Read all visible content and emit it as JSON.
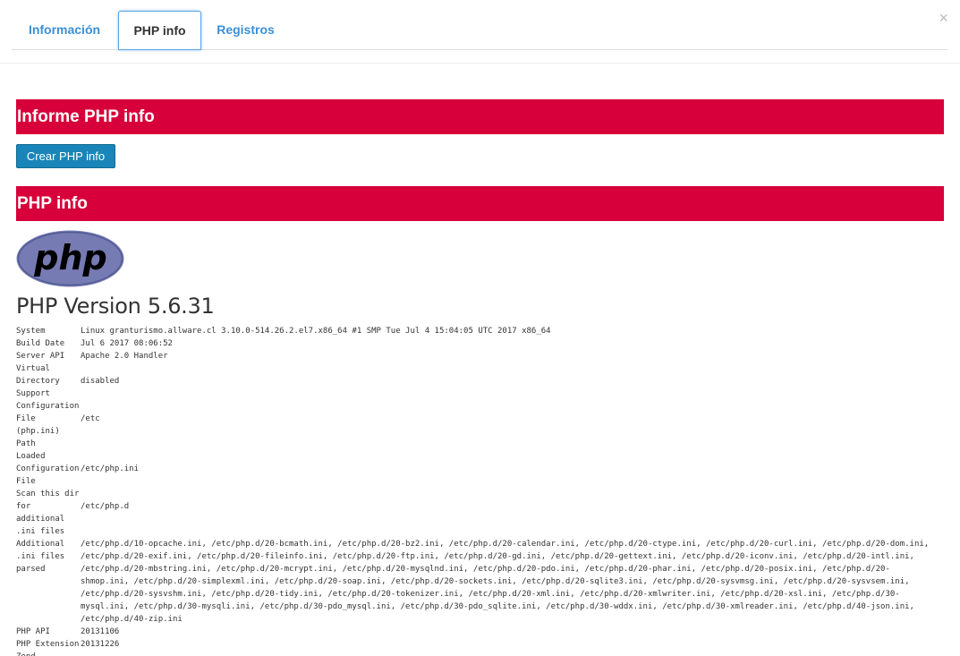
{
  "tabs": [
    {
      "label": "Información"
    },
    {
      "label": "PHP info"
    },
    {
      "label": "Registros"
    }
  ],
  "close_label": "×",
  "sections": {
    "informe_title": "Informe PHP info",
    "create_button": "Crear PHP info",
    "phpinfo_title": "PHP info"
  },
  "logo_text": "php",
  "php_version": "PHP Version 5.6.31",
  "colors": {
    "header_red": "#d7003a",
    "button_blue": "#1a85b8",
    "tab_link": "#3a8fd6"
  },
  "info": {
    "rows": [
      {
        "label": [
          "System"
        ],
        "value": [
          "Linux granturismo.allware.cl 3.10.0-514.26.2.el7.x86_64 #1 SMP Tue Jul 4 15:04:05 UTC 2017 x86_64"
        ]
      },
      {
        "label": [
          "Build Date"
        ],
        "value": [
          "Jul 6 2017 08:06:52"
        ]
      },
      {
        "label": [
          "Server API"
        ],
        "value": [
          "Apache 2.0 Handler"
        ]
      },
      {
        "label": [
          "Virtual",
          "Directory",
          "Support"
        ],
        "value": [
          "disabled"
        ]
      },
      {
        "label": [
          "Configuration",
          "File",
          "(php.ini)",
          "Path"
        ],
        "value": [
          "/etc"
        ]
      },
      {
        "label": [
          "Loaded",
          "Configuration",
          "File"
        ],
        "value": [
          "/etc/php.ini"
        ]
      },
      {
        "label": [
          "Scan this dir",
          "for",
          "additional",
          ".ini files"
        ],
        "value": [
          "/etc/php.d"
        ]
      },
      {
        "label": [
          "Additional",
          ".ini files",
          "parsed"
        ],
        "value": [
          "/etc/php.d/10-opcache.ini, /etc/php.d/20-bcmath.ini, /etc/php.d/20-bz2.ini, /etc/php.d/20-calendar.ini, /etc/php.d/20-ctype.ini, /etc/php.d/20-curl.ini, /etc/php.d/20-dom.ini,",
          "/etc/php.d/20-exif.ini, /etc/php.d/20-fileinfo.ini, /etc/php.d/20-ftp.ini, /etc/php.d/20-gd.ini, /etc/php.d/20-gettext.ini, /etc/php.d/20-iconv.ini, /etc/php.d/20-intl.ini,",
          "/etc/php.d/20-mbstring.ini, /etc/php.d/20-mcrypt.ini, /etc/php.d/20-mysqlnd.ini, /etc/php.d/20-pdo.ini, /etc/php.d/20-phar.ini, /etc/php.d/20-posix.ini, /etc/php.d/20-",
          "shmop.ini, /etc/php.d/20-simplexml.ini, /etc/php.d/20-soap.ini, /etc/php.d/20-sockets.ini, /etc/php.d/20-sqlite3.ini, /etc/php.d/20-sysvmsg.ini, /etc/php.d/20-sysvsem.ini,",
          "/etc/php.d/20-sysvshm.ini, /etc/php.d/20-tidy.ini, /etc/php.d/20-tokenizer.ini, /etc/php.d/20-xml.ini, /etc/php.d/20-xmlwriter.ini, /etc/php.d/20-xsl.ini, /etc/php.d/30-",
          "mysql.ini, /etc/php.d/30-mysqli.ini, /etc/php.d/30-pdo_mysql.ini, /etc/php.d/30-pdo_sqlite.ini, /etc/php.d/30-wddx.ini, /etc/php.d/30-xmlreader.ini, /etc/php.d/40-json.ini,",
          "/etc/php.d/40-zip.ini"
        ]
      },
      {
        "label": [
          "PHP API"
        ],
        "value": [
          "20131106"
        ]
      },
      {
        "label": [
          "PHP Extension"
        ],
        "value": [
          "20131226"
        ]
      },
      {
        "label": [
          "Zend"
        ],
        "value": [
          ""
        ]
      }
    ]
  }
}
